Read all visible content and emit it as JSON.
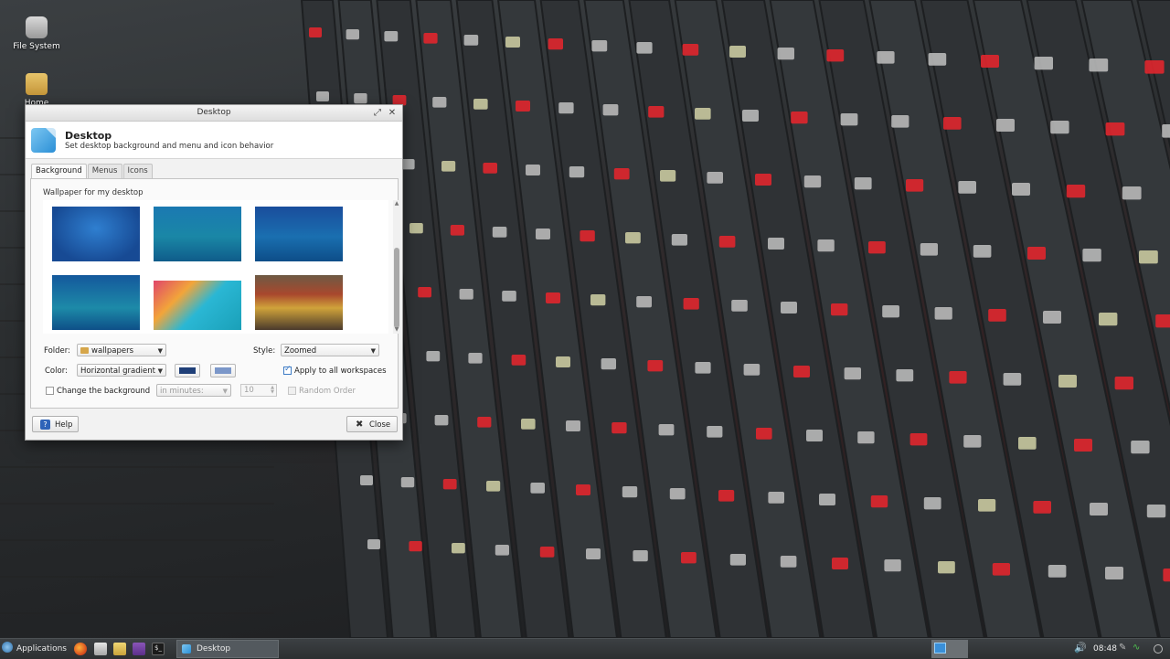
{
  "desktop": {
    "icons": [
      {
        "label": "File System"
      },
      {
        "label": "Home"
      }
    ]
  },
  "dialog": {
    "title": "Desktop",
    "header_title": "Desktop",
    "header_subtitle": "Set desktop background and menu and icon behavior",
    "tabs": [
      {
        "label": "Background",
        "active": true
      },
      {
        "label": "Menus",
        "active": false
      },
      {
        "label": "Icons",
        "active": false
      }
    ],
    "wallpaper_label": "Wallpaper for my desktop",
    "folder_label": "Folder:",
    "folder_value": "wallpapers",
    "style_label": "Style:",
    "style_value": "Zoomed",
    "color_label": "Color:",
    "color_value": "Horizontal gradient",
    "color1": "#1f3f78",
    "color2": "#7b97c9",
    "apply_all_label": "Apply to all workspaces",
    "apply_all_checked": true,
    "change_bg_label": "Change the background",
    "change_bg_checked": false,
    "interval_unit": "in minutes:",
    "interval_value": "10",
    "random_order_label": "Random Order",
    "help_label": "Help",
    "close_label": "Close"
  },
  "taskbar": {
    "apps_label": "Applications",
    "task_label": "Desktop",
    "terminal_glyph": "$_",
    "clock": "08:48"
  }
}
